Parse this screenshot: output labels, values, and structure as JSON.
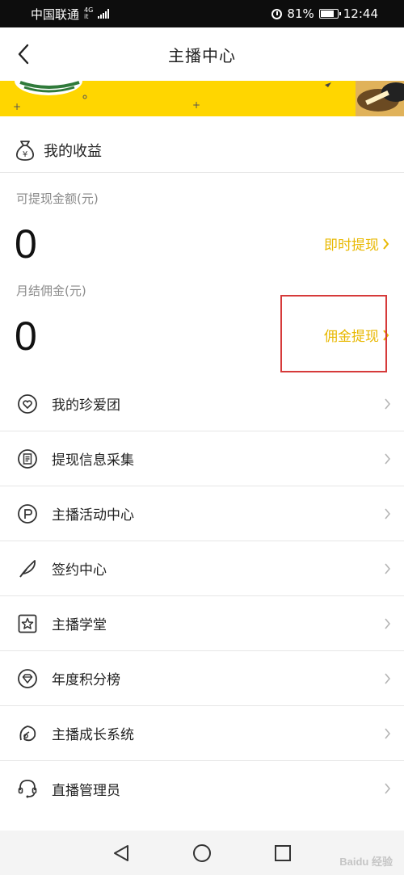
{
  "status_bar": {
    "carrier": "中国联通",
    "network_top": "4G",
    "network_bottom": "it",
    "battery": "81%",
    "time": "12:44"
  },
  "nav": {
    "title": "主播中心",
    "back_icon": "chevron-left-icon"
  },
  "earnings": {
    "title": "我的收益",
    "icon": "money-bag-icon",
    "withdrawable_label": "可提现金额(元)",
    "withdrawable_value": "0",
    "instant_withdraw_label": "即时提现",
    "monthly_commission_label": "月结佣金(元)",
    "monthly_commission_value": "0",
    "commission_withdraw_label": "佣金提现"
  },
  "menu": [
    {
      "label": "我的珍爱团",
      "icon": "heart-circle-icon"
    },
    {
      "label": "提现信息采集",
      "icon": "document-icon"
    },
    {
      "label": "主播活动中心",
      "icon": "flag-circle-icon"
    },
    {
      "label": "签约中心",
      "icon": "feather-icon"
    },
    {
      "label": "主播学堂",
      "icon": "star-square-icon"
    },
    {
      "label": "年度积分榜",
      "icon": "diamond-icon"
    },
    {
      "label": "主播成长系统",
      "icon": "leaf-icon"
    },
    {
      "label": "直播管理员",
      "icon": "headset-icon"
    }
  ],
  "colors": {
    "accent": "#e8b800",
    "banner": "#ffd600",
    "highlight": "#d63a3a"
  },
  "watermark": "Baidu 经验"
}
